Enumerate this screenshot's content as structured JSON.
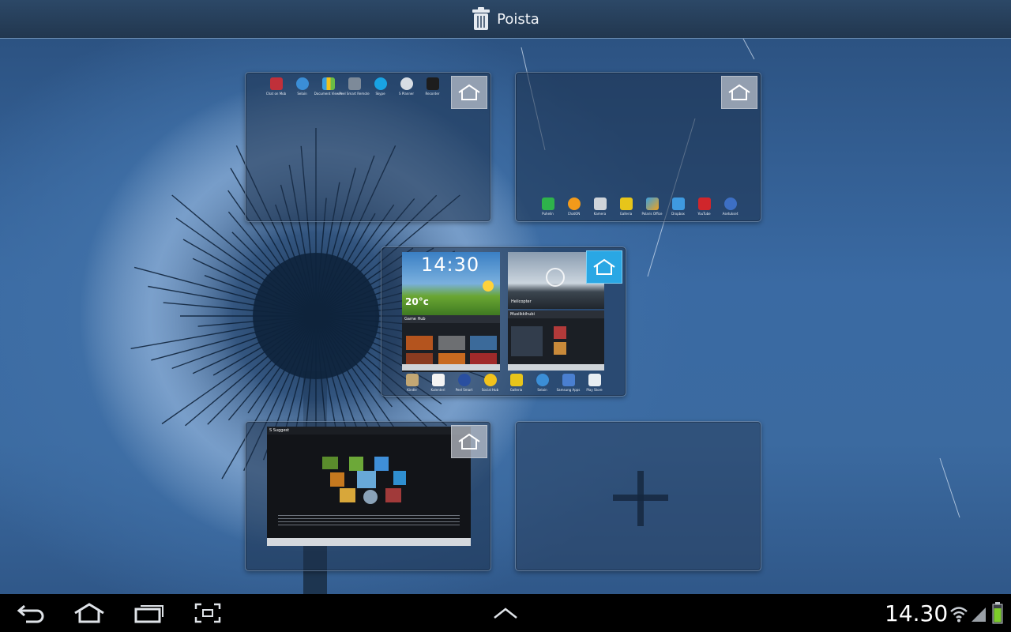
{
  "top_bar": {
    "delete_label": "Poista"
  },
  "pages": {
    "page1": {
      "apps": [
        "Chat on Mob",
        "Selain",
        "Document Viewer",
        "Peel Smart Remote",
        "Skype",
        "S Planner",
        "Recorder"
      ]
    },
    "page2": {
      "apps": [
        "Puhelin",
        "ChatON",
        "Kamera",
        "Galleria",
        "Polaris Office",
        "Dropbox",
        "YouTube",
        "Asetukset"
      ]
    },
    "page3": {
      "clock_time": "14:30",
      "temperature": "20°c",
      "game_hub_title": "Game Hub",
      "video_title": "Helicopter",
      "music_title": "Musiikkihubi",
      "apps": [
        "Kindle",
        "Kalenteri",
        "Peel Smart",
        "Social Hub",
        "Galleria",
        "Selain",
        "Samsung Apps",
        "Play Store"
      ]
    },
    "page4": {
      "title": "S Suggest"
    }
  },
  "status_bar": {
    "time": "14.30"
  },
  "colors": {
    "top_bar": "#22374f",
    "active_home": "#2aa7e4",
    "nav_bar": "#000000"
  },
  "icons": {
    "top_bar": "trash-icon",
    "nav": [
      "back-icon",
      "home-icon",
      "recent-apps-icon",
      "screenshot-icon",
      "chevron-up-icon"
    ],
    "status": [
      "wifi-icon",
      "signal-icon",
      "battery-icon"
    ]
  }
}
